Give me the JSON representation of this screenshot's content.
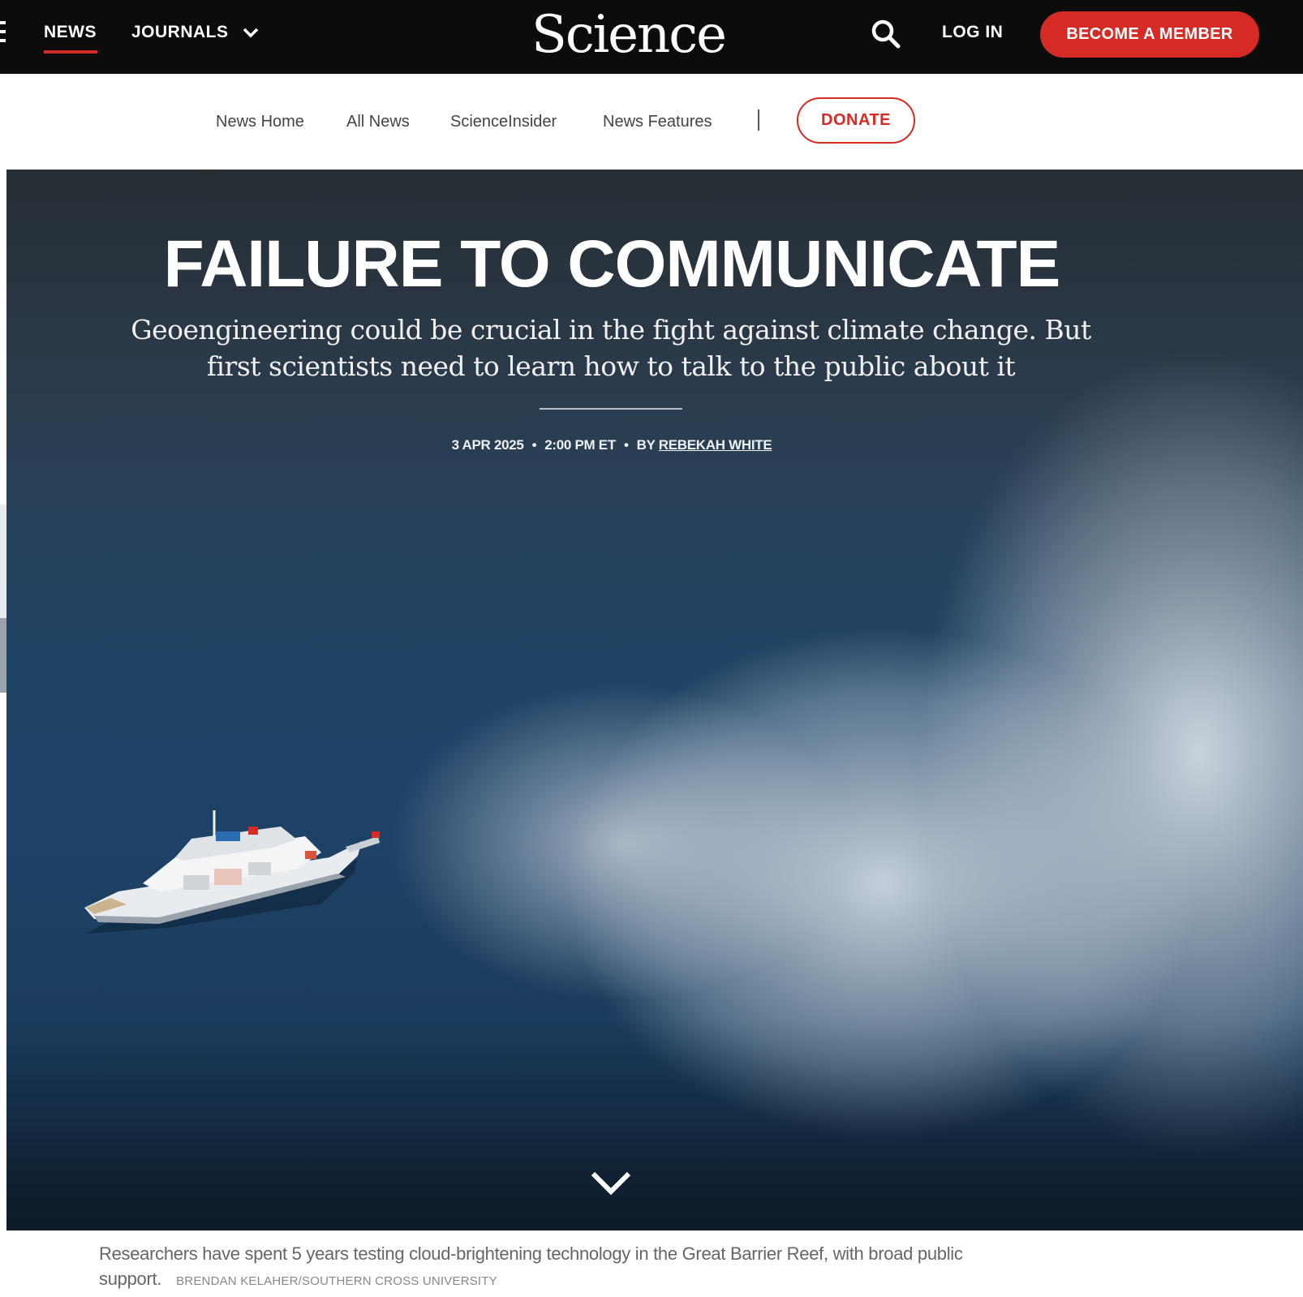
{
  "topbar": {
    "news_label": "NEWS",
    "journals_label": "JOURNALS",
    "logo_text": "Science",
    "login_label": "LOG IN",
    "member_label": "BECOME A MEMBER",
    "accent_color": "#d62b24"
  },
  "subnav": {
    "items": [
      "News Home",
      "All News",
      "ScienceInsider",
      "News Features"
    ],
    "donate_label": "DONATE"
  },
  "article": {
    "headline": "FAILURE TO COMMUNICATE",
    "dek": "Geoengineering could be crucial in the fight against climate change. But first scientists need to learn how to talk to the public about it",
    "date": "3 APR 2025",
    "time": "2:00 PM ET",
    "by_prefix": "BY",
    "author": "REBEKAH WHITE",
    "caption": "Researchers have spent 5 years testing cloud-brightening technology in the Great Barrier Reef, with broad public support.",
    "credit": "BRENDAN KELAHER/SOUTHERN CROSS UNIVERSITY"
  },
  "icons": {
    "menu": "menu-icon",
    "journals_chevron": "chevron-down-icon",
    "search": "search-icon",
    "scroll": "chevron-down-icon"
  }
}
